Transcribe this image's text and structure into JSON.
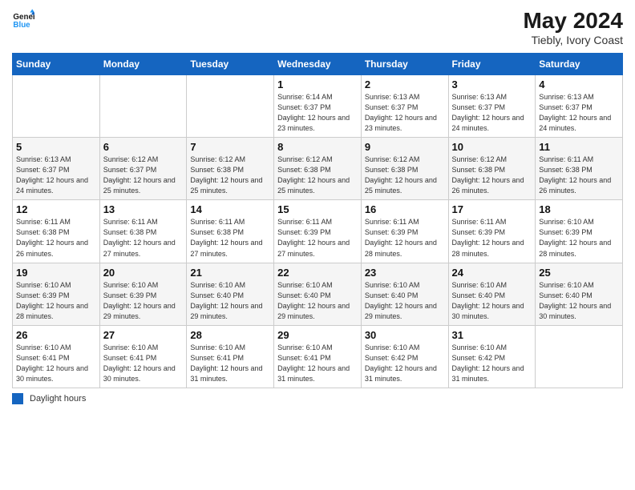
{
  "header": {
    "logo_line1": "General",
    "logo_line2": "Blue",
    "month_year": "May 2024",
    "location": "Tiebly, Ivory Coast"
  },
  "days_of_week": [
    "Sunday",
    "Monday",
    "Tuesday",
    "Wednesday",
    "Thursday",
    "Friday",
    "Saturday"
  ],
  "weeks": [
    [
      {
        "day": "",
        "sunrise": "",
        "sunset": "",
        "daylight": ""
      },
      {
        "day": "",
        "sunrise": "",
        "sunset": "",
        "daylight": ""
      },
      {
        "day": "",
        "sunrise": "",
        "sunset": "",
        "daylight": ""
      },
      {
        "day": "1",
        "sunrise": "Sunrise: 6:14 AM",
        "sunset": "Sunset: 6:37 PM",
        "daylight": "Daylight: 12 hours and 23 minutes."
      },
      {
        "day": "2",
        "sunrise": "Sunrise: 6:13 AM",
        "sunset": "Sunset: 6:37 PM",
        "daylight": "Daylight: 12 hours and 23 minutes."
      },
      {
        "day": "3",
        "sunrise": "Sunrise: 6:13 AM",
        "sunset": "Sunset: 6:37 PM",
        "daylight": "Daylight: 12 hours and 24 minutes."
      },
      {
        "day": "4",
        "sunrise": "Sunrise: 6:13 AM",
        "sunset": "Sunset: 6:37 PM",
        "daylight": "Daylight: 12 hours and 24 minutes."
      }
    ],
    [
      {
        "day": "5",
        "sunrise": "Sunrise: 6:13 AM",
        "sunset": "Sunset: 6:37 PM",
        "daylight": "Daylight: 12 hours and 24 minutes."
      },
      {
        "day": "6",
        "sunrise": "Sunrise: 6:12 AM",
        "sunset": "Sunset: 6:37 PM",
        "daylight": "Daylight: 12 hours and 25 minutes."
      },
      {
        "day": "7",
        "sunrise": "Sunrise: 6:12 AM",
        "sunset": "Sunset: 6:38 PM",
        "daylight": "Daylight: 12 hours and 25 minutes."
      },
      {
        "day": "8",
        "sunrise": "Sunrise: 6:12 AM",
        "sunset": "Sunset: 6:38 PM",
        "daylight": "Daylight: 12 hours and 25 minutes."
      },
      {
        "day": "9",
        "sunrise": "Sunrise: 6:12 AM",
        "sunset": "Sunset: 6:38 PM",
        "daylight": "Daylight: 12 hours and 25 minutes."
      },
      {
        "day": "10",
        "sunrise": "Sunrise: 6:12 AM",
        "sunset": "Sunset: 6:38 PM",
        "daylight": "Daylight: 12 hours and 26 minutes."
      },
      {
        "day": "11",
        "sunrise": "Sunrise: 6:11 AM",
        "sunset": "Sunset: 6:38 PM",
        "daylight": "Daylight: 12 hours and 26 minutes."
      }
    ],
    [
      {
        "day": "12",
        "sunrise": "Sunrise: 6:11 AM",
        "sunset": "Sunset: 6:38 PM",
        "daylight": "Daylight: 12 hours and 26 minutes."
      },
      {
        "day": "13",
        "sunrise": "Sunrise: 6:11 AM",
        "sunset": "Sunset: 6:38 PM",
        "daylight": "Daylight: 12 hours and 27 minutes."
      },
      {
        "day": "14",
        "sunrise": "Sunrise: 6:11 AM",
        "sunset": "Sunset: 6:38 PM",
        "daylight": "Daylight: 12 hours and 27 minutes."
      },
      {
        "day": "15",
        "sunrise": "Sunrise: 6:11 AM",
        "sunset": "Sunset: 6:39 PM",
        "daylight": "Daylight: 12 hours and 27 minutes."
      },
      {
        "day": "16",
        "sunrise": "Sunrise: 6:11 AM",
        "sunset": "Sunset: 6:39 PM",
        "daylight": "Daylight: 12 hours and 28 minutes."
      },
      {
        "day": "17",
        "sunrise": "Sunrise: 6:11 AM",
        "sunset": "Sunset: 6:39 PM",
        "daylight": "Daylight: 12 hours and 28 minutes."
      },
      {
        "day": "18",
        "sunrise": "Sunrise: 6:10 AM",
        "sunset": "Sunset: 6:39 PM",
        "daylight": "Daylight: 12 hours and 28 minutes."
      }
    ],
    [
      {
        "day": "19",
        "sunrise": "Sunrise: 6:10 AM",
        "sunset": "Sunset: 6:39 PM",
        "daylight": "Daylight: 12 hours and 28 minutes."
      },
      {
        "day": "20",
        "sunrise": "Sunrise: 6:10 AM",
        "sunset": "Sunset: 6:39 PM",
        "daylight": "Daylight: 12 hours and 29 minutes."
      },
      {
        "day": "21",
        "sunrise": "Sunrise: 6:10 AM",
        "sunset": "Sunset: 6:40 PM",
        "daylight": "Daylight: 12 hours and 29 minutes."
      },
      {
        "day": "22",
        "sunrise": "Sunrise: 6:10 AM",
        "sunset": "Sunset: 6:40 PM",
        "daylight": "Daylight: 12 hours and 29 minutes."
      },
      {
        "day": "23",
        "sunrise": "Sunrise: 6:10 AM",
        "sunset": "Sunset: 6:40 PM",
        "daylight": "Daylight: 12 hours and 29 minutes."
      },
      {
        "day": "24",
        "sunrise": "Sunrise: 6:10 AM",
        "sunset": "Sunset: 6:40 PM",
        "daylight": "Daylight: 12 hours and 30 minutes."
      },
      {
        "day": "25",
        "sunrise": "Sunrise: 6:10 AM",
        "sunset": "Sunset: 6:40 PM",
        "daylight": "Daylight: 12 hours and 30 minutes."
      }
    ],
    [
      {
        "day": "26",
        "sunrise": "Sunrise: 6:10 AM",
        "sunset": "Sunset: 6:41 PM",
        "daylight": "Daylight: 12 hours and 30 minutes."
      },
      {
        "day": "27",
        "sunrise": "Sunrise: 6:10 AM",
        "sunset": "Sunset: 6:41 PM",
        "daylight": "Daylight: 12 hours and 30 minutes."
      },
      {
        "day": "28",
        "sunrise": "Sunrise: 6:10 AM",
        "sunset": "Sunset: 6:41 PM",
        "daylight": "Daylight: 12 hours and 31 minutes."
      },
      {
        "day": "29",
        "sunrise": "Sunrise: 6:10 AM",
        "sunset": "Sunset: 6:41 PM",
        "daylight": "Daylight: 12 hours and 31 minutes."
      },
      {
        "day": "30",
        "sunrise": "Sunrise: 6:10 AM",
        "sunset": "Sunset: 6:42 PM",
        "daylight": "Daylight: 12 hours and 31 minutes."
      },
      {
        "day": "31",
        "sunrise": "Sunrise: 6:10 AM",
        "sunset": "Sunset: 6:42 PM",
        "daylight": "Daylight: 12 hours and 31 minutes."
      },
      {
        "day": "",
        "sunrise": "",
        "sunset": "",
        "daylight": ""
      }
    ]
  ],
  "footer": {
    "daylight_label": "Daylight hours"
  }
}
